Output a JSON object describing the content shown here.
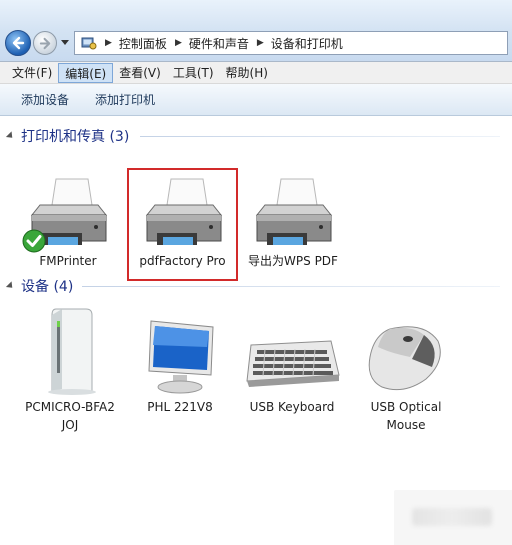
{
  "breadcrumb": [
    "控制面板",
    "硬件和声音",
    "设备和打印机"
  ],
  "menu": [
    {
      "label": "文件(F)",
      "active": false
    },
    {
      "label": "编辑(E)",
      "active": true
    },
    {
      "label": "查看(V)",
      "active": false
    },
    {
      "label": "工具(T)",
      "active": false
    },
    {
      "label": "帮助(H)",
      "active": false
    }
  ],
  "commands": {
    "add_device": "添加设备",
    "add_printer": "添加打印机"
  },
  "printers_group": {
    "title": "打印机和传真 (3)"
  },
  "printers": [
    {
      "label": "FMPrinter",
      "default": true
    },
    {
      "label": "pdfFactory Pro",
      "default": false,
      "selected": true
    },
    {
      "label": "导出为WPS PDF",
      "default": false
    }
  ],
  "devices_group": {
    "title": "设备 (4)"
  },
  "devices": [
    {
      "label_line1": "PCMICRO-BFA2",
      "label_line2": "JOJ",
      "icon": "computer-tower-icon"
    },
    {
      "label_line1": "PHL 221V8",
      "label_line2": "",
      "icon": "monitor-icon"
    },
    {
      "label_line1": "USB Keyboard",
      "label_line2": "",
      "icon": "keyboard-icon"
    },
    {
      "label_line1": "USB Optical",
      "label_line2": "Mouse",
      "icon": "mouse-icon"
    }
  ]
}
